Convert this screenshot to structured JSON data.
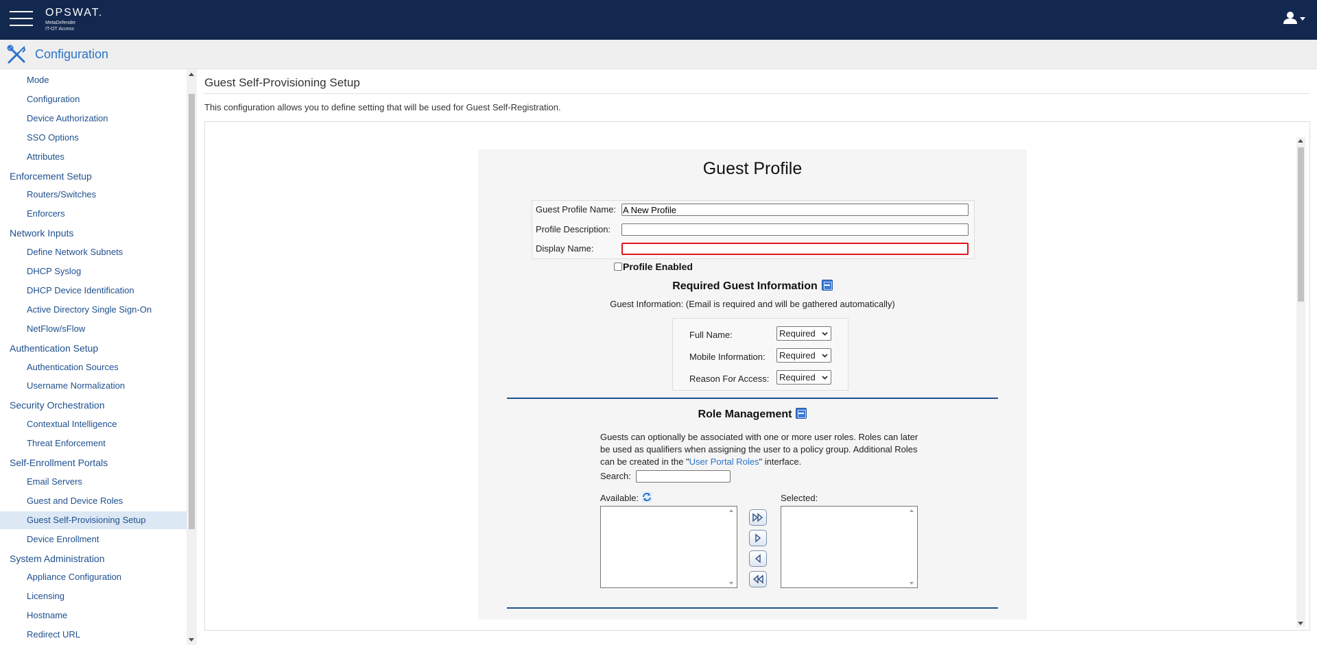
{
  "app": {
    "brand": "OPSWAT.",
    "product_line1": "MetaDefender",
    "product_line2": "IT-OT Access"
  },
  "header": {
    "title": "Configuration"
  },
  "sidebar": {
    "items": [
      {
        "label": "Mode",
        "level": "sub"
      },
      {
        "label": "Configuration",
        "level": "sub"
      },
      {
        "label": "Device Authorization",
        "level": "sub"
      },
      {
        "label": "SSO Options",
        "level": "sub"
      },
      {
        "label": "Attributes",
        "level": "sub"
      },
      {
        "label": "Enforcement Setup",
        "level": "head"
      },
      {
        "label": "Routers/Switches",
        "level": "sub"
      },
      {
        "label": "Enforcers",
        "level": "sub"
      },
      {
        "label": "Network Inputs",
        "level": "head"
      },
      {
        "label": "Define Network Subnets",
        "level": "sub"
      },
      {
        "label": "DHCP Syslog",
        "level": "sub"
      },
      {
        "label": "DHCP Device Identification",
        "level": "sub"
      },
      {
        "label": "Active Directory Single Sign-On",
        "level": "sub"
      },
      {
        "label": "NetFlow/sFlow",
        "level": "sub"
      },
      {
        "label": "Authentication Setup",
        "level": "head"
      },
      {
        "label": "Authentication Sources",
        "level": "sub"
      },
      {
        "label": "Username Normalization",
        "level": "sub"
      },
      {
        "label": "Security Orchestration",
        "level": "head"
      },
      {
        "label": "Contextual Intelligence",
        "level": "sub"
      },
      {
        "label": "Threat Enforcement",
        "level": "sub"
      },
      {
        "label": "Self-Enrollment Portals",
        "level": "head"
      },
      {
        "label": "Email Servers",
        "level": "sub"
      },
      {
        "label": "Guest and Device Roles",
        "level": "sub"
      },
      {
        "label": "Guest Self-Provisioning Setup",
        "level": "sub",
        "active": true
      },
      {
        "label": "Device Enrollment",
        "level": "sub"
      },
      {
        "label": "System Administration",
        "level": "head"
      },
      {
        "label": "Appliance Configuration",
        "level": "sub"
      },
      {
        "label": "Licensing",
        "level": "sub"
      },
      {
        "label": "Hostname",
        "level": "sub"
      },
      {
        "label": "Redirect URL",
        "level": "sub"
      }
    ]
  },
  "main": {
    "page_title": "Guest Self-Provisioning Setup",
    "description": "This configuration allows you to define setting that will be used for Guest Self-Registration."
  },
  "profile": {
    "title": "Guest Profile",
    "name_label": "Guest Profile Name:",
    "name_value": "A New Profile",
    "description_label": "Profile Description:",
    "description_value": "",
    "display_label": "Display Name:",
    "display_value": "",
    "enabled_label": "Profile Enabled",
    "enabled": false
  },
  "guest_info": {
    "heading": "Required Guest Information",
    "note": "Guest Information: (Email is required and will be gathered automatically)",
    "fields": [
      {
        "label": "Full Name:",
        "value": "Required"
      },
      {
        "label": "Mobile Information:",
        "value": "Required"
      },
      {
        "label": "Reason For Access:",
        "value": "Required"
      }
    ]
  },
  "roles": {
    "heading": "Role Management",
    "desc_before": "Guests can optionally be associated with one or more user roles. Roles can later be used as qualifiers when assigning the user to a policy group. Additional Roles can be created in the \"",
    "desc_link": "User Portal Roles",
    "desc_after": "\" interface.",
    "search_label": "Search:",
    "search_value": "",
    "available_label": "Available:",
    "selected_label": "Selected:",
    "available": [],
    "selected": []
  },
  "icons": {
    "menu": "hamburger-menu-icon",
    "user": "user-icon",
    "config": "tools-icon",
    "collapse": "collapse-icon",
    "refresh": "refresh-icon",
    "add_all": "double-right-arrow-icon",
    "add": "right-arrow-icon",
    "remove": "left-arrow-icon",
    "remove_all": "double-left-arrow-icon"
  },
  "colors": {
    "topbar": "#13284e",
    "accent": "#2a72c9",
    "nav_text": "#1e4f8e",
    "active_bg": "#dde8f5",
    "invalid_border": "#e0141e",
    "section_rule": "#1f4f8e"
  }
}
